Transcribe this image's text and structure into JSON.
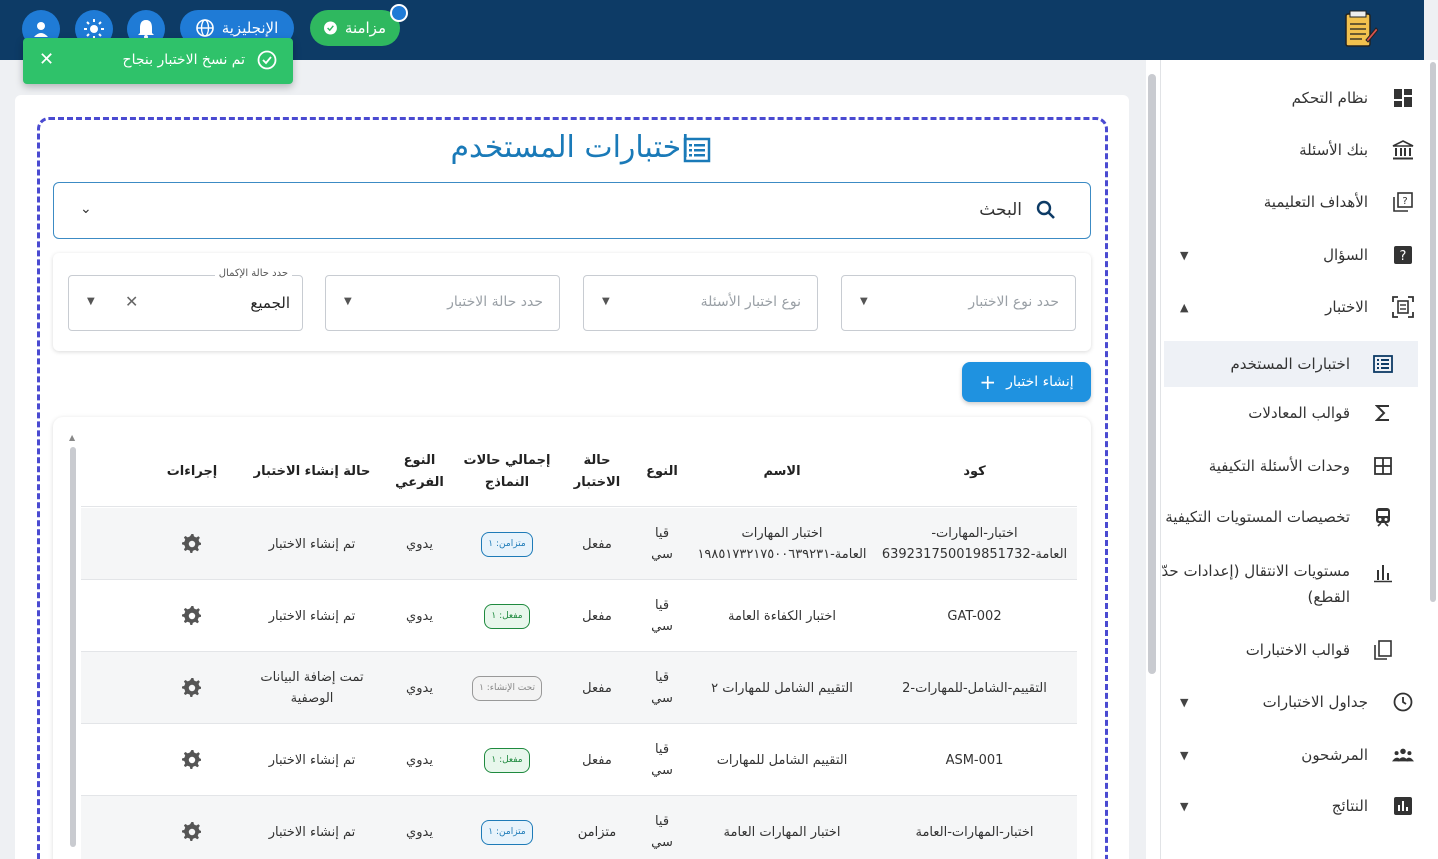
{
  "topbar": {
    "language_label": "الإنجليزية",
    "sync_label": "مزامنة"
  },
  "toast": {
    "message": "تم نسخ الاختبار بنجاح"
  },
  "sidebar": {
    "items": [
      {
        "label": "نظام التحكم",
        "icon": "dashboard-icon"
      },
      {
        "label": "بنك الأسئلة",
        "icon": "bank-icon"
      },
      {
        "label": "الأهداف التعليمية",
        "icon": "objectives-icon"
      },
      {
        "label": "السؤال",
        "icon": "question-icon"
      },
      {
        "label": "الاختبار",
        "icon": "exam-icon"
      },
      {
        "label": "اختبارات المستخدم",
        "icon": "list-icon"
      },
      {
        "label": "قوالب المعادلات",
        "icon": "sigma-icon"
      },
      {
        "label": "وحدات الأسئلة التكيفية",
        "icon": "grid-icon"
      },
      {
        "label": "تخصيصات المستويات التكيفية",
        "icon": "train-icon"
      },
      {
        "label": "مستويات الانتقال (إعدادات حدّ القطع)",
        "icon": "bar-chart-icon"
      },
      {
        "label": "قوالب الاختبارات",
        "icon": "template-icon"
      },
      {
        "label": "جداول الاختبارات",
        "icon": "clock-icon"
      },
      {
        "label": "المرشحون",
        "icon": "people-icon"
      },
      {
        "label": "النتائج",
        "icon": "results-icon"
      }
    ]
  },
  "page": {
    "title": "اختبارات المستخدم",
    "search_label": "البحث",
    "create_button": "إنشاء اختبار"
  },
  "filters": {
    "exam_type_placeholder": "حدد نوع الاختبار",
    "question_type_placeholder": "نوع اختبار الأسئلة",
    "exam_status_placeholder": "حدد حالة الاختبار",
    "completion_legend": "حدد حالة الإكمال",
    "completion_value": "الجميع"
  },
  "table": {
    "headers": {
      "code": "كود",
      "name": "الاسم",
      "type": "النوع",
      "status": "حالة الاختبار",
      "total_forms": "إجمالي حالات النماذج",
      "subtype": "النوع الفرعي",
      "creation_status": "حالة إنشاء الاختبار",
      "actions": "إجراءات"
    },
    "rows": [
      {
        "code": "اختبار-المهارات-العامة-639231750019851732",
        "name": "اختبار المهارات العامة-١٩٨٥١٧٣٢١٧٥٠٠٦٣٩٢٣١",
        "type": "قيا سي",
        "status": "مفعل",
        "badge": "متزامن: ١",
        "badge_color": "blue",
        "subtype": "يدوي",
        "creation": "تم إنشاء الاختبار"
      },
      {
        "code": "GAT-002",
        "name": "اختبار الكفاءة العامة",
        "type": "قيا سي",
        "status": "مفعل",
        "badge": "مفعل: ١",
        "badge_color": "green",
        "subtype": "يدوي",
        "creation": "تم إنشاء الاختبار"
      },
      {
        "code": "التقييم-الشامل-للمهارات-2",
        "name": "التقييم الشامل للمهارات ٢",
        "type": "قيا سي",
        "status": "مفعل",
        "badge": "تحت الإنشاء: ١",
        "badge_color": "gray",
        "subtype": "يدوي",
        "creation": "تمت إضافة البيانات الوصفية"
      },
      {
        "code": "ASM-001",
        "name": "التقييم الشامل للمهارات",
        "type": "قيا سي",
        "status": "مفعل",
        "badge": "مفعل: ١",
        "badge_color": "green",
        "subtype": "يدوي",
        "creation": "تم إنشاء الاختبار"
      },
      {
        "code": "اختبار-المهارات-العامة",
        "name": "اختبار المهارات العامة",
        "type": "قيا سي",
        "status": "متزامن",
        "badge": "متزامن: ١",
        "badge_color": "blue",
        "subtype": "يدوي",
        "creation": "تم إنشاء الاختبار"
      }
    ]
  }
}
